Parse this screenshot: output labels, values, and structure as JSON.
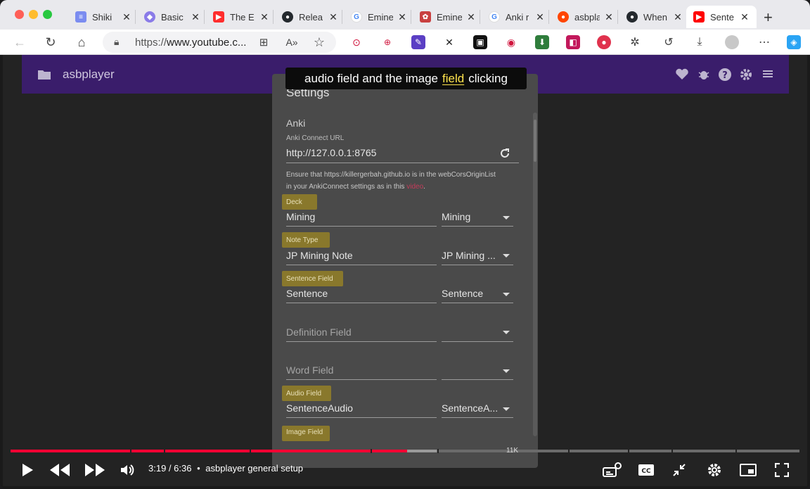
{
  "tabs": [
    {
      "label": "Shiki",
      "icon": "doc-icon",
      "color": "#6f7ee6"
    },
    {
      "label": "Basic",
      "icon": "circle-icon",
      "color": "#8a7be8"
    },
    {
      "label": "The E",
      "icon": "youtube-icon",
      "color": "#ff2d2d"
    },
    {
      "label": "Relea",
      "icon": "github-icon",
      "color": "#24292e"
    },
    {
      "label": "Emine",
      "icon": "google-icon",
      "color": "#4285f4"
    },
    {
      "label": "Emine",
      "icon": "anki-icon",
      "color": "#c94040"
    },
    {
      "label": "Anki r",
      "icon": "google-icon",
      "color": "#4285f4"
    },
    {
      "label": "asbpla",
      "icon": "reddit-icon",
      "color": "#ff4500"
    },
    {
      "label": "When",
      "icon": "github-icon",
      "color": "#24292e"
    },
    {
      "label": "Sente",
      "icon": "youtube-icon",
      "color": "#ff0000"
    }
  ],
  "address_bar": {
    "url_prefix": "https://",
    "url_host": "www.youtube.c..."
  },
  "app": {
    "title": "asbplayer"
  },
  "settings": {
    "title": "Settings",
    "section": "Anki",
    "anki_connect_label": "Anki Connect URL",
    "anki_connect_value": "http://127.0.0.1:8765",
    "note_line1": "Ensure that https://killergerbah.github.io is in the webCorsOriginList",
    "note_line2_pre": "in your AnkiConnect settings as in this",
    "note_link": "video",
    "deck_label": "Deck",
    "deck_value": "Mining",
    "deck_select": "Mining",
    "note_type_label": "Note Type",
    "note_type_value": "JP Mining Note",
    "note_type_select": "JP Mining ...",
    "sentence_label": "Sentence Field",
    "sentence_value": "Sentence",
    "sentence_select": "Sentence",
    "definition_placeholder": "Definition Field",
    "word_placeholder": "Word Field",
    "audio_label": "Audio Field",
    "audio_value": "SentenceAudio",
    "audio_select": "SentenceA...",
    "image_label": "Image Field"
  },
  "caption": {
    "before": "audio field and the image",
    "highlight": "field",
    "after": "clicking"
  },
  "player": {
    "time_current": "3:19",
    "time_total": "6:36",
    "chapter_title": "asbplayer general setup",
    "progress_fraction": 0.503,
    "buffer_fraction": 0.54,
    "chapter_marker": "11K"
  },
  "colors": {
    "accent": "#3a1d6b",
    "progress": "#ff0033",
    "highlight": "#8c7a2a"
  }
}
